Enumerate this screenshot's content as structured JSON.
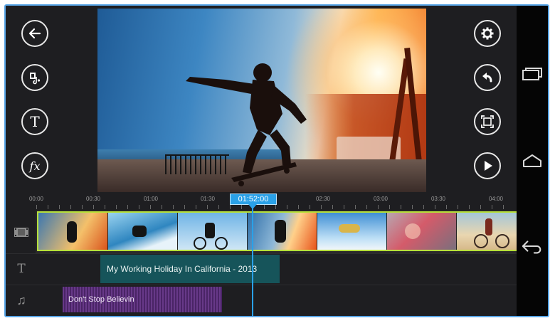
{
  "left_toolbar": {
    "back_icon": "back-arrow-icon",
    "media_icon": "media-library-icon",
    "text_icon": "text-title-icon",
    "fx_icon": "effects-fx-icon",
    "text_glyph": "T",
    "fx_glyph": "fx"
  },
  "right_toolbar": {
    "settings_icon": "gear-icon",
    "undo_icon": "undo-icon",
    "crop_icon": "fullscreen-frame-icon",
    "play_icon": "play-icon"
  },
  "timeline": {
    "current_time": "01:52:00",
    "ruler_labels": [
      "00:00",
      "00:30",
      "01:00",
      "01:30",
      "02:30",
      "03:00",
      "03:30",
      "04:00"
    ],
    "video_thumbnails": [
      "skateboarder-sunset",
      "surfer-wave",
      "bmx-rider-sky",
      "skateboarder-sunset",
      "snowboarder-jump",
      "blurred-lights",
      "cyclist-dusk"
    ],
    "text_clip_label": "My Working Holiday In California - 2013",
    "audio_clip_label": "Don't Stop Believin",
    "track_icons": [
      "video-track-icon",
      "text-track-icon",
      "music-track-icon"
    ],
    "text_track_glyph": "T",
    "music_track_glyph": "♫"
  },
  "android_nav": {
    "recents_icon": "recent-apps-icon",
    "home_icon": "home-icon",
    "back_icon": "back-icon"
  },
  "colors": {
    "accent": "#2aa1e8",
    "video_clip_border": "#b7e03a",
    "text_clip": "#16545a",
    "audio_clip": "#4a2466"
  }
}
